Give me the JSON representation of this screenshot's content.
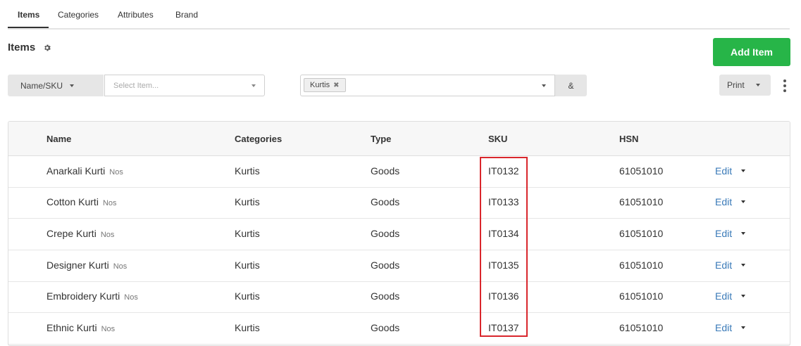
{
  "tabs": [
    {
      "label": "Items",
      "active": true
    },
    {
      "label": "Categories",
      "active": false
    },
    {
      "label": "Attributes",
      "active": false
    },
    {
      "label": "Brand",
      "active": false
    }
  ],
  "page": {
    "title": "Items",
    "settings_icon": "gear-icon"
  },
  "buttons": {
    "add_item": "Add Item",
    "print": "Print",
    "and": "&",
    "more_icon": "kebab-icon"
  },
  "filters": {
    "search_mode": "Name/SKU",
    "item_placeholder": "Select Item...",
    "category_chips": [
      {
        "label": "Kurtis",
        "remove_icon": "close-icon"
      }
    ]
  },
  "table": {
    "columns": [
      "Name",
      "Categories",
      "Type",
      "SKU",
      "HSN"
    ],
    "rows": [
      {
        "name": "Anarkali Kurti",
        "unit": "Nos",
        "category": "Kurtis",
        "type": "Goods",
        "sku": "IT0132",
        "hsn": "61051010",
        "action": "Edit"
      },
      {
        "name": "Cotton Kurti",
        "unit": "Nos",
        "category": "Kurtis",
        "type": "Goods",
        "sku": "IT0133",
        "hsn": "61051010",
        "action": "Edit"
      },
      {
        "name": "Crepe Kurti",
        "unit": "Nos",
        "category": "Kurtis",
        "type": "Goods",
        "sku": "IT0134",
        "hsn": "61051010",
        "action": "Edit"
      },
      {
        "name": "Designer Kurti",
        "unit": "Nos",
        "category": "Kurtis",
        "type": "Goods",
        "sku": "IT0135",
        "hsn": "61051010",
        "action": "Edit"
      },
      {
        "name": "Embroidery Kurti",
        "unit": "Nos",
        "category": "Kurtis",
        "type": "Goods",
        "sku": "IT0136",
        "hsn": "61051010",
        "action": "Edit"
      },
      {
        "name": "Ethnic Kurti",
        "unit": "Nos",
        "category": "Kurtis",
        "type": "Goods",
        "sku": "IT0137",
        "hsn": "61051010",
        "action": "Edit"
      }
    ]
  },
  "colors": {
    "primary": "#27b548",
    "link": "#3a7ab8",
    "highlight": "#d9262c"
  }
}
